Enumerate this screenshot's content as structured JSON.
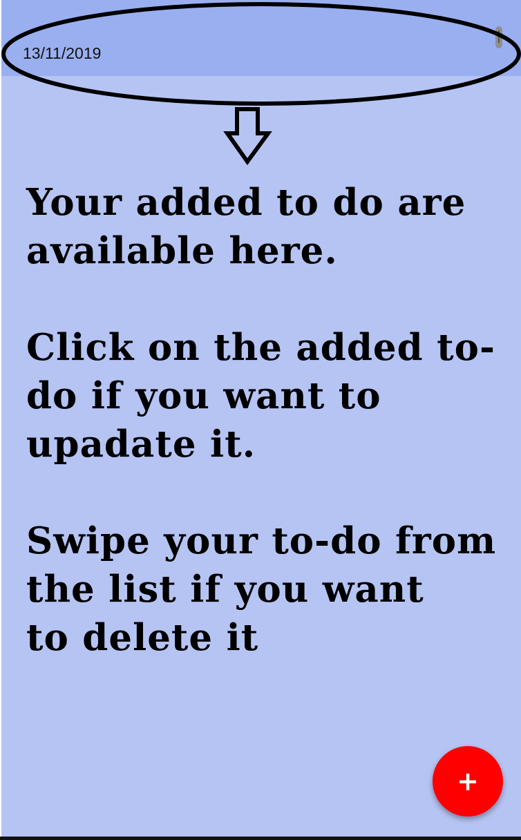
{
  "header": {
    "date": "13/11/2019"
  },
  "annotation": {
    "lines": [
      "Your added to do are\navailable here.",
      "Click on the added to-\ndo if you want to\nupadate it.",
      "Swipe your to-do from\nthe list   if you want\nto delete it"
    ]
  },
  "fab": {
    "icon": "plus-icon",
    "symbol": "+",
    "color": "#ff0000"
  },
  "colors": {
    "background": "#b6c4f3",
    "header_row": "#9aaff0",
    "annotation_stroke": "#000000"
  }
}
